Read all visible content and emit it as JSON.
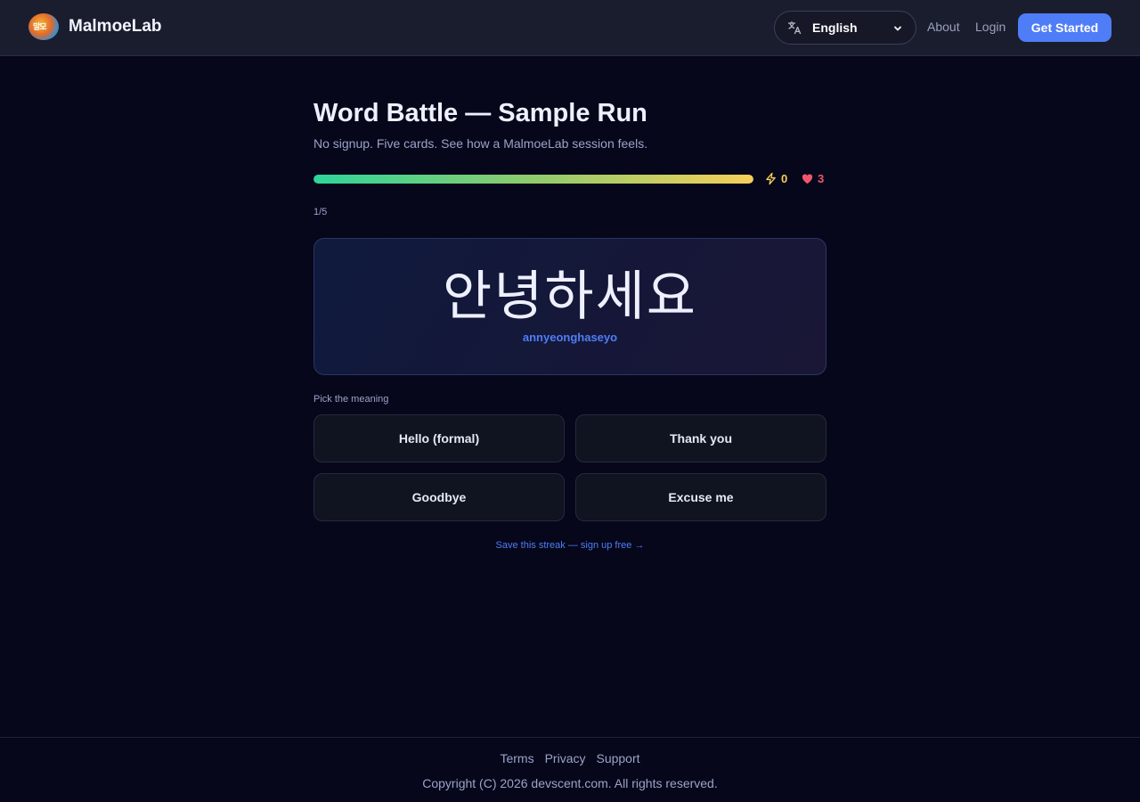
{
  "header": {
    "brand_name": "MalmoeLab",
    "language_selected": "English",
    "nav": {
      "about": "About",
      "login": "Login"
    },
    "cta_label": "Get Started"
  },
  "main": {
    "title": "Word Battle — Sample Run",
    "subtitle": "No signup. Five cards. See how a MalmoeLab session feels.",
    "progress": 1.0,
    "energy_count": "0",
    "lives_count": "3",
    "card_counter": "1/5",
    "card": {
      "word": "안녕하세요",
      "romanization": "annyeonghaseyo"
    },
    "pick_label": "Pick the meaning",
    "options": [
      {
        "label": "Hello (formal)"
      },
      {
        "label": "Thank you"
      },
      {
        "label": "Goodbye"
      },
      {
        "label": "Excuse me"
      }
    ],
    "save_link": "Save this streak — sign up free →"
  },
  "footer": {
    "links": [
      "Terms",
      "Privacy",
      "Support"
    ],
    "copyright": "Copyright (C) 2026 devscent.com. All rights reserved."
  },
  "colors": {
    "accent": "#4f7df7",
    "energy": "#f6cf5a",
    "lives": "#f0566b",
    "background": "#06071a"
  },
  "icons": {
    "logo": "malmoelab-logo",
    "language": "translate-icon",
    "dropdown": "chevron-down-icon",
    "energy": "lightning-icon",
    "lives": "heart-icon"
  }
}
